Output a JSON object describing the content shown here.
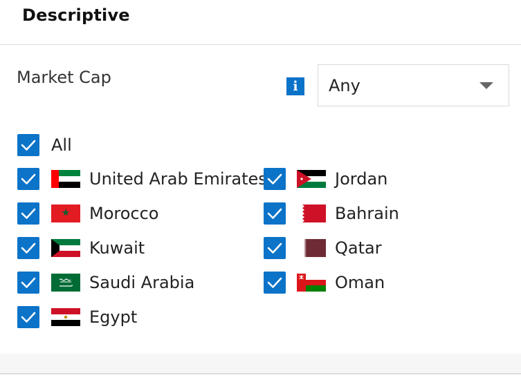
{
  "section": {
    "title": "Descriptive"
  },
  "filter": {
    "label": "Market Cap",
    "info_icon_glyph": "i",
    "select_value": "Any"
  },
  "all_option": {
    "label": "All",
    "checked": true
  },
  "countries": [
    {
      "label": "United Arab Emirates",
      "flag": "uae-flag-icon",
      "checked": true
    },
    {
      "label": "Jordan",
      "flag": "jordan-flag-icon",
      "checked": true
    },
    {
      "label": "Morocco",
      "flag": "morocco-flag-icon",
      "checked": true
    },
    {
      "label": "Bahrain",
      "flag": "bahrain-flag-icon",
      "checked": true
    },
    {
      "label": "Kuwait",
      "flag": "kuwait-flag-icon",
      "checked": true
    },
    {
      "label": "Qatar",
      "flag": "qatar-flag-icon",
      "checked": true
    },
    {
      "label": "Saudi Arabia",
      "flag": "saudi-arabia-flag-icon",
      "checked": true
    },
    {
      "label": "Oman",
      "flag": "oman-flag-icon",
      "checked": true
    },
    {
      "label": "Egypt",
      "flag": "egypt-flag-icon",
      "checked": true
    }
  ],
  "colors": {
    "checkbox": "#0b73c8",
    "info_icon": "#0b73c8"
  }
}
